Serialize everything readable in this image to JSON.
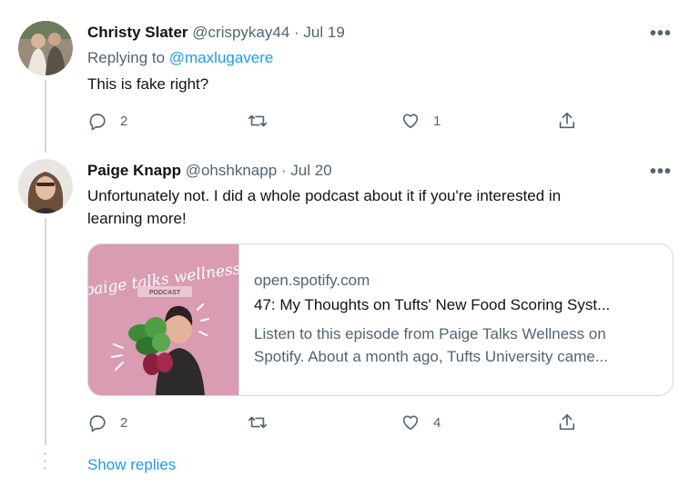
{
  "tweets": [
    {
      "name": "Christy Slater",
      "handle": "@crispykay44",
      "date": "· Jul 19",
      "replying_label": "Replying to",
      "replying_handle": "@maxlugavere",
      "text": "This is fake right?",
      "replies": "2",
      "retweets": "",
      "likes": "1"
    },
    {
      "name": "Paige Knapp",
      "handle": "@ohshknapp",
      "date": "· Jul 20",
      "text_line1": "Unfortunately not. I did a whole podcast about it if you're interested in",
      "text_line2": "learning more!",
      "replies": "2",
      "retweets": "",
      "likes": "4",
      "card": {
        "domain": "open.spotify.com",
        "title": "47: My Thoughts on Tufts' New Food Scoring Syst...",
        "desc_line1": "Listen to this episode from Paige Talks Wellness on",
        "desc_line2": "Spotify. About a month ago, Tufts University came...",
        "image_script": "paige talks wellness",
        "image_badge": "PODCAST"
      }
    }
  ],
  "more_label": "•••",
  "show_replies": "Show replies",
  "colors": {
    "accent": "#1d9bf0",
    "secondary_text": "#536471",
    "border": "#cfd9de",
    "card_bg": "#d99cb2"
  },
  "icons": [
    "reply-icon",
    "retweet-icon",
    "like-icon",
    "share-icon",
    "more-icon"
  ]
}
